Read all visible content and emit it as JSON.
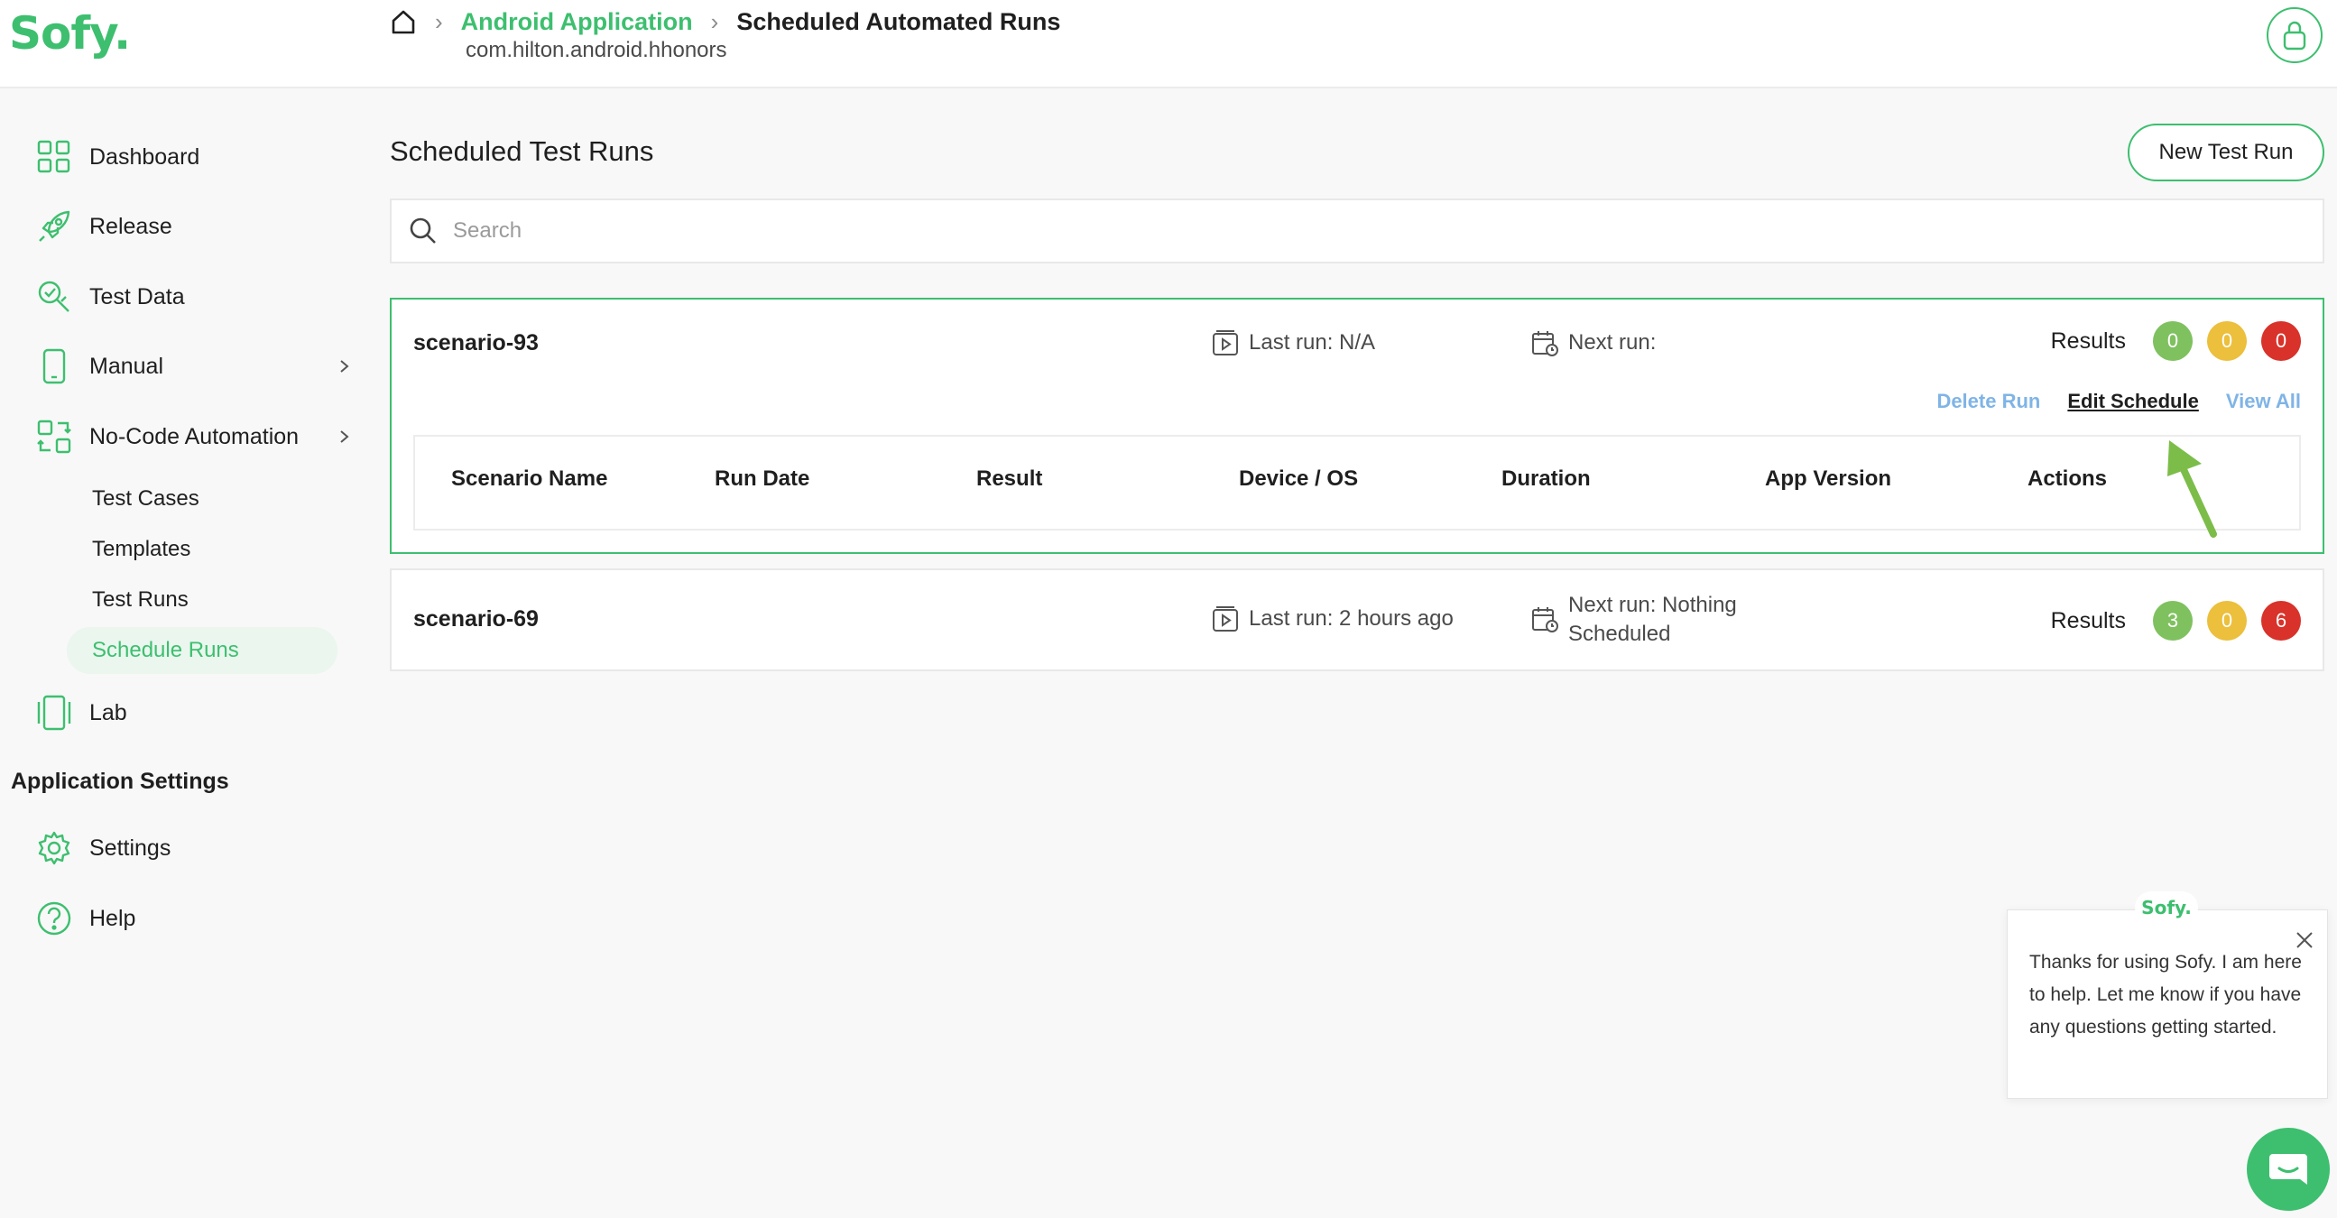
{
  "colors": {
    "brand": "#3dbf6f",
    "link": "#7fb4e6",
    "pass": "#7fc15f",
    "warn": "#ecbf3c",
    "fail": "#d8322a"
  },
  "header": {
    "logo": "Sofy.",
    "breadcrumb": {
      "home_icon": "home-icon",
      "parent": "Android Application",
      "current": "Scheduled Automated Runs"
    },
    "package": "com.hilton.android.hhonors",
    "avatar_icon": "user-icon"
  },
  "sidebar": {
    "items": [
      {
        "label": "Dashboard",
        "icon": "dashboard-icon"
      },
      {
        "label": "Release",
        "icon": "rocket-icon"
      },
      {
        "label": "Test Data",
        "icon": "test-data-icon"
      },
      {
        "label": "Manual",
        "icon": "mobile-icon"
      },
      {
        "label": "No-Code Automation",
        "icon": "automation-icon"
      },
      {
        "label": "Lab",
        "icon": "device-lab-icon"
      }
    ],
    "sub_items": [
      {
        "label": "Test Cases"
      },
      {
        "label": "Templates"
      },
      {
        "label": "Test Runs"
      },
      {
        "label": "Schedule Runs",
        "active": true
      }
    ],
    "section_title": "Application Settings",
    "settings_items": [
      {
        "label": "Settings",
        "icon": "gear-icon"
      },
      {
        "label": "Help",
        "icon": "help-icon"
      }
    ]
  },
  "main": {
    "title": "Scheduled Test Runs",
    "new_run_label": "New Test Run",
    "search_placeholder": "Search",
    "runs": [
      {
        "name": "scenario-93",
        "last_run": "Last run: N/A",
        "next_run": "Next run:",
        "results_label": "Results",
        "results": {
          "passed": "0",
          "warning": "0",
          "failed": "0"
        },
        "actions": {
          "delete": "Delete Run",
          "edit": "Edit Schedule",
          "view": "View All"
        },
        "table_headers": [
          "Scenario Name",
          "Run Date",
          "Result",
          "Device / OS",
          "Duration",
          "App Version",
          "Actions"
        ]
      },
      {
        "name": "scenario-69",
        "last_run": "Last run: 2 hours ago",
        "next_run_line1": "Next run: Nothing",
        "next_run_line2": "Scheduled",
        "results_label": "Results",
        "results": {
          "passed": "3",
          "warning": "0",
          "failed": "6"
        }
      }
    ]
  },
  "chat": {
    "brand": "Sofy.",
    "message": "Thanks for using Sofy. I am here to help. Let me know if you have any questions getting started.",
    "close_icon": "close-icon",
    "launcher_icon": "chat-bubble-icon"
  }
}
